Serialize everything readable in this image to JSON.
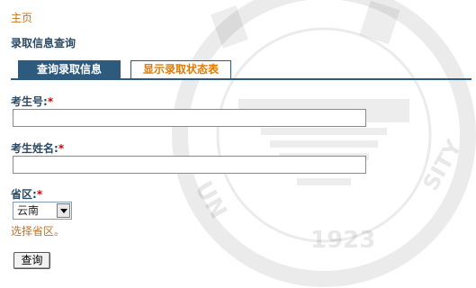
{
  "breadcrumb": {
    "home": "主页"
  },
  "page": {
    "title": "录取信息查询"
  },
  "tabs": [
    {
      "label": "查询录取信息",
      "active": true
    },
    {
      "label": "显示录取状态表",
      "active": false
    }
  ],
  "form": {
    "exam_number": {
      "label": "考生号:",
      "required_mark": "*",
      "value": ""
    },
    "student_name": {
      "label": "考生姓名:",
      "required_mark": "*",
      "value": ""
    },
    "province": {
      "label": "省区:",
      "required_mark": "*",
      "selected": "云南",
      "hint": "选择省区。"
    },
    "submit_label": "查询"
  },
  "watermark": {
    "text": "YUNNAN UNIVERSITY",
    "year": "1923"
  },
  "colors": {
    "accent": "#2e5a7d",
    "tab_inactive_text": "#e07b00",
    "hint": "#c8731e",
    "required": "#d40000"
  }
}
